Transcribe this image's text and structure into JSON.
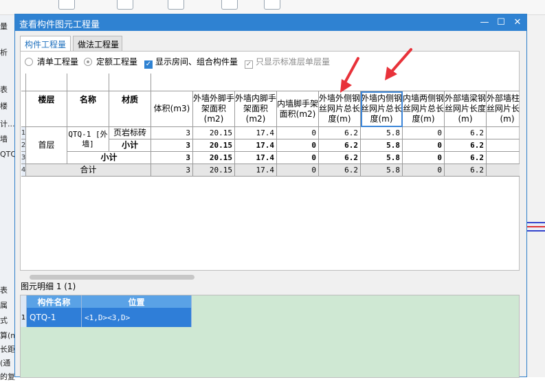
{
  "background": {
    "toolbar_icons": [
      "toolbar-icon-1",
      "toolbar-icon-2",
      "toolbar-icon-3",
      "toolbar-icon-4",
      "toolbar-icon-5"
    ],
    "left_fragments": [
      "量",
      "析",
      "表",
      "楼",
      "计...",
      "墙",
      "QTQ",
      "表",
      "属",
      "式",
      "算(m",
      "长距",
      "(通",
      "的复"
    ],
    "right_marker_color": "#e03030"
  },
  "dialog": {
    "title": "查看构件图元工程量",
    "tabs": [
      {
        "label": "构件工程量",
        "active": true
      },
      {
        "label": "做法工程量",
        "active": false
      }
    ],
    "options": {
      "radio_list": "清单工程量",
      "radio_quota": "定额工程量",
      "check_show_room": "显示房间、组合构件量",
      "check_standard_floor": "只显示标准层单层量"
    },
    "table": {
      "headers": [
        "楼层",
        "名称",
        "材质",
        "体积(m3)",
        "外墙外脚手架面积(m2)",
        "外墙内脚手架面积(m2)",
        "内墙脚手架面积(m2)",
        "外墙外侧钢丝网片总长度(m)",
        "外墙内侧钢丝网片总长度(m)",
        "内墙两侧钢丝网片总长度(m)",
        "外部墙梁钢丝网片长度(m)",
        "外部墙柱钢丝网片长度(m)"
      ],
      "row_numbers": [
        "1",
        "2",
        "3",
        "4"
      ],
      "floor": "首层",
      "name": "QTQ-1 [外墙]",
      "material": "页岩标砖",
      "subtotal_label": "小计",
      "total_label": "合计",
      "rows": [
        [
          "3",
          "20.15",
          "17.4",
          "0",
          "6.2",
          "5.8",
          "0",
          "6.2",
          ""
        ],
        [
          "3",
          "20.15",
          "17.4",
          "0",
          "6.2",
          "5.8",
          "0",
          "6.2",
          ""
        ],
        [
          "3",
          "20.15",
          "17.4",
          "0",
          "6.2",
          "5.8",
          "0",
          "6.2",
          ""
        ],
        [
          "3",
          "20.15",
          "17.4",
          "0",
          "6.2",
          "5.8",
          "0",
          "6.2",
          ""
        ]
      ]
    },
    "detail": {
      "label": "图元明细  1 (1)",
      "headers": [
        "构件名称",
        "位置"
      ],
      "row_number": "1",
      "row": [
        "QTQ-1",
        "<1,D><3,D>"
      ]
    }
  },
  "annotation_color": "#e8323a"
}
